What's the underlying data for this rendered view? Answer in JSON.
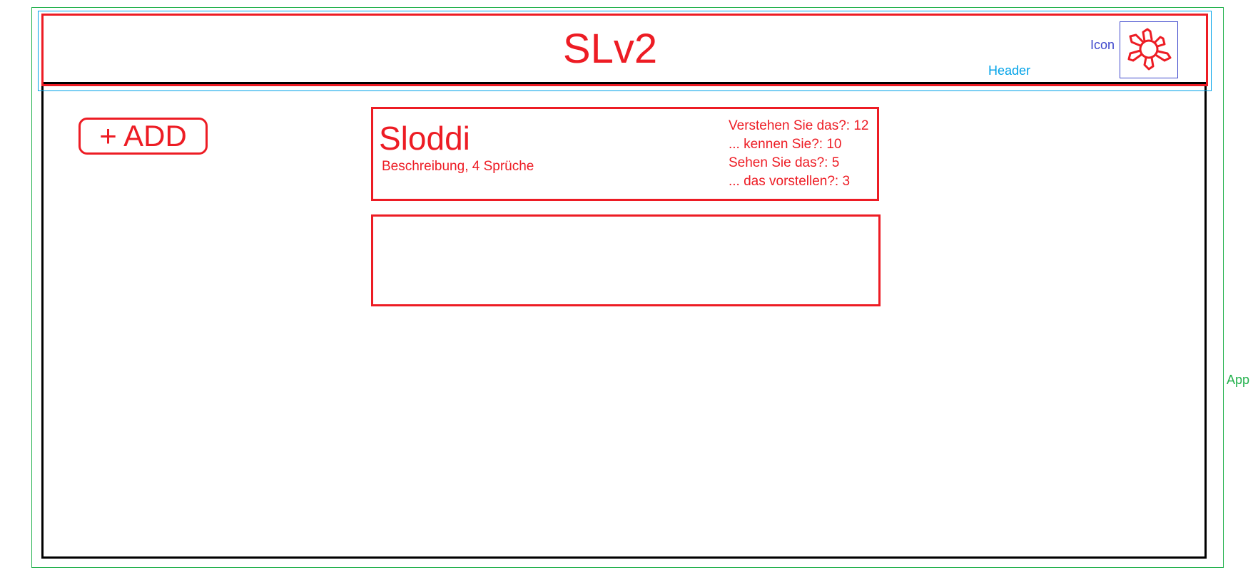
{
  "app": {
    "label": "App",
    "title": "SLv2"
  },
  "header": {
    "label": "Header",
    "icon_label": "Icon",
    "icon": "sun-doodle-icon"
  },
  "toolbar": {
    "add_label": "+ ADD"
  },
  "cards": [
    {
      "name": "Sloddi",
      "description": "Beschreibung, 4 Sprüche",
      "stats": [
        "Verstehen Sie das?: 12",
        "... kennen Sie?: 10",
        "Sehen Sie das?: 5",
        "... das vorstellen?: 3"
      ]
    }
  ],
  "colors": {
    "sketch_red": "#ed1c24",
    "app_green": "#22b14c",
    "header_blue": "#00a2e8",
    "icon_blue": "#3f48cc",
    "frame_black": "#000000"
  }
}
